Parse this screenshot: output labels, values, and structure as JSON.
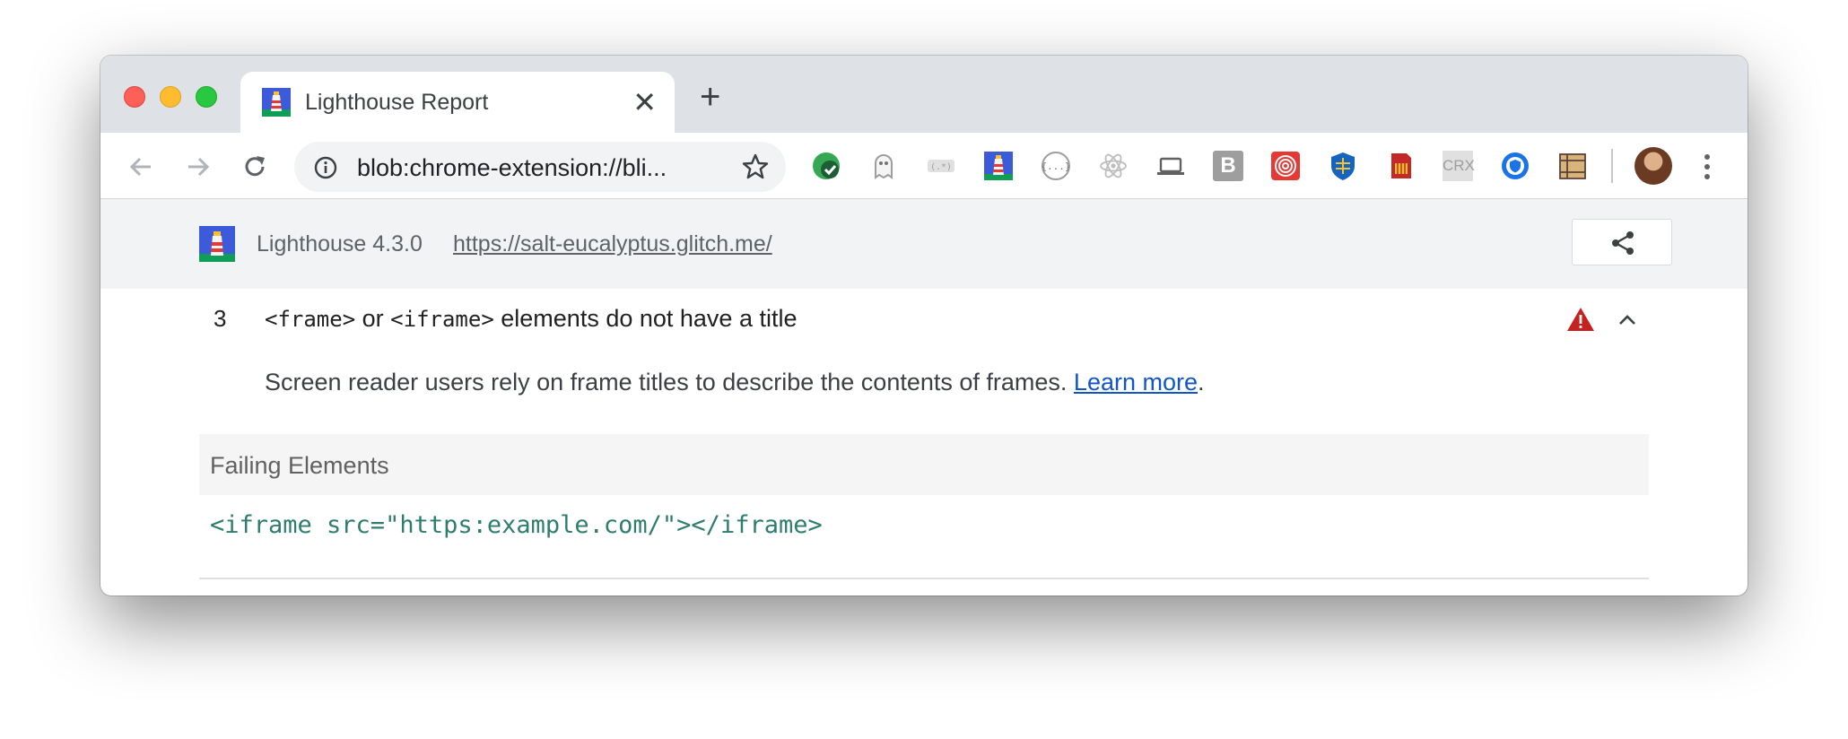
{
  "tab": {
    "title": "Lighthouse Report",
    "close_glyph": "✕",
    "new_tab_glyph": "+"
  },
  "omnibox": {
    "url": "blob:chrome-extension://bli..."
  },
  "extensions": [
    "green-check-icon",
    "ghost-icon",
    "regex-icon",
    "lighthouse-icon",
    "json-braces-icon",
    "react-icon",
    "laptop-icon",
    "b-icon",
    "target-icon",
    "shield-icon",
    "sd-card-icon",
    "crx-icon",
    "privacy-badger-icon",
    "ruler-icon"
  ],
  "extension_labels": {
    "b": "B",
    "crx": "CRX"
  },
  "lighthouse": {
    "version": "Lighthouse 4.3.0",
    "url": "https://salt-eucalyptus.glitch.me/"
  },
  "audit": {
    "index": "3",
    "title_code_1": "<frame>",
    "title_or": " or ",
    "title_code_2": "<iframe>",
    "title_rest": " elements do not have a title",
    "description": "Screen reader users rely on frame titles to describe the contents of frames. ",
    "learn_more": "Learn more",
    "period": ".",
    "failing_header": "Failing Elements",
    "failing_node": "<iframe src=\"https:example.com/\"></iframe>"
  },
  "colors": {
    "tabstrip": "#dee1e6",
    "topbar": "#f1f3f4",
    "warning": "#c5221f",
    "code": "#2e7d6e",
    "link": "#1155cc"
  }
}
